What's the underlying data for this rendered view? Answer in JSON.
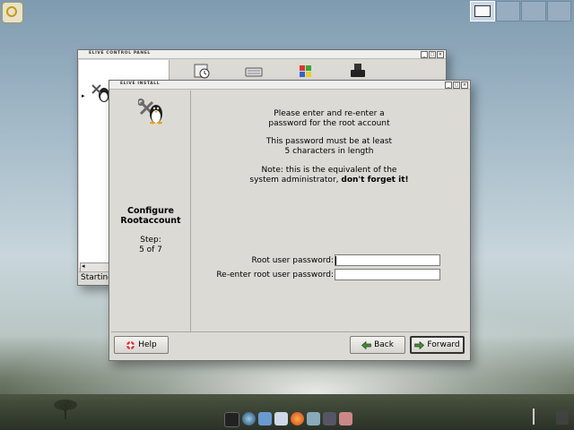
{
  "desktop": {
    "pager_desks": 4,
    "taskbar_icons": [
      "monitor-icon",
      "globe-icon",
      "folder-icon",
      "files-icon",
      "browser-icon",
      "tools-icon",
      "network-icon",
      "settings-icon"
    ]
  },
  "control_panel": {
    "title": "ELIVE CONTROL PANEL",
    "status": "Starting",
    "scroll_left": "◂"
  },
  "installer": {
    "title": "ELIVE INSTALL",
    "window_buttons": [
      "_",
      "□",
      "×"
    ],
    "sidebar": {
      "title_line1": "Configure",
      "title_line2": "Rootaccount",
      "step_label": "Step:",
      "step_value": "5 of 7"
    },
    "message": {
      "line1": "Please enter and re-enter a",
      "line2": "password for the root account",
      "line3": "This password must be at least",
      "line4": "5 characters in length",
      "line5": "Note: this is the equivalent of the",
      "line6_prefix": "system administrator, ",
      "line6_bold": "don't forget it!"
    },
    "form": {
      "root_label": "Root user password:",
      "reenter_label": "Re-enter root user password:",
      "root_value": "",
      "reenter_value": ""
    },
    "buttons": {
      "help": "Help",
      "back": "Back",
      "forward": "Forward"
    }
  }
}
